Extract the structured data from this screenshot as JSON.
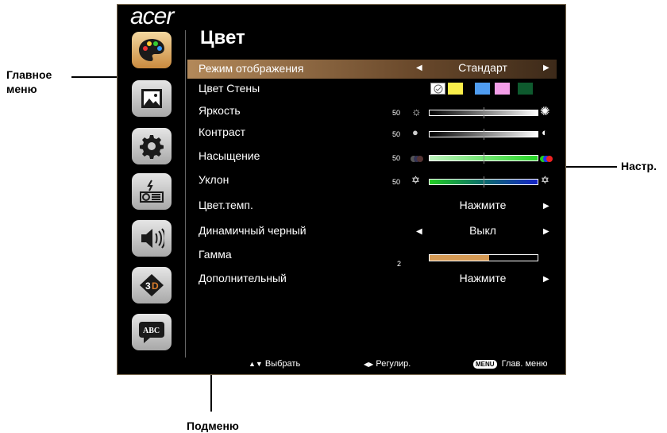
{
  "callouts": {
    "main_menu": "Главное\nменю",
    "settings": "Настр.",
    "submenu": "Подменю"
  },
  "osd": {
    "brand": "acer",
    "title": "Цвет",
    "sidebar_icons": [
      "palette-icon",
      "image-icon",
      "gear-icon",
      "projector-icon",
      "speaker-icon",
      "3d-icon",
      "abc-language-icon"
    ],
    "rows": {
      "display_mode": {
        "label": "Режим отображения",
        "value": "Стандарт"
      },
      "wall_color": {
        "label": "Цвет Стены",
        "swatches": [
          "#ffffff",
          "#f9ee4a",
          "#4f9df1",
          "#f39ee8",
          "#0e5a2e"
        ]
      },
      "brightness": {
        "label": "Яркость",
        "value": "50",
        "level": 0.5
      },
      "contrast": {
        "label": "Контраст",
        "value": "50",
        "level": 0.5
      },
      "saturation": {
        "label": "Насыщение",
        "value": "50",
        "level": 0.5
      },
      "tint": {
        "label": "Уклон",
        "value": "50",
        "level": 0.5
      },
      "color_temp": {
        "label": "Цвет.темп.",
        "value": "Нажмите"
      },
      "dynamic_black": {
        "label": "Динамичный черный",
        "value": "Выкл"
      },
      "gamma": {
        "label": "Гамма",
        "value": "2",
        "level": 0.55
      },
      "advanced": {
        "label": "Дополнительный",
        "value": "Нажмите"
      }
    },
    "footer": {
      "select": "Выбрать",
      "adjust": "Регулир.",
      "menu_key": "MENU",
      "main_menu": "Глав. меню"
    }
  }
}
